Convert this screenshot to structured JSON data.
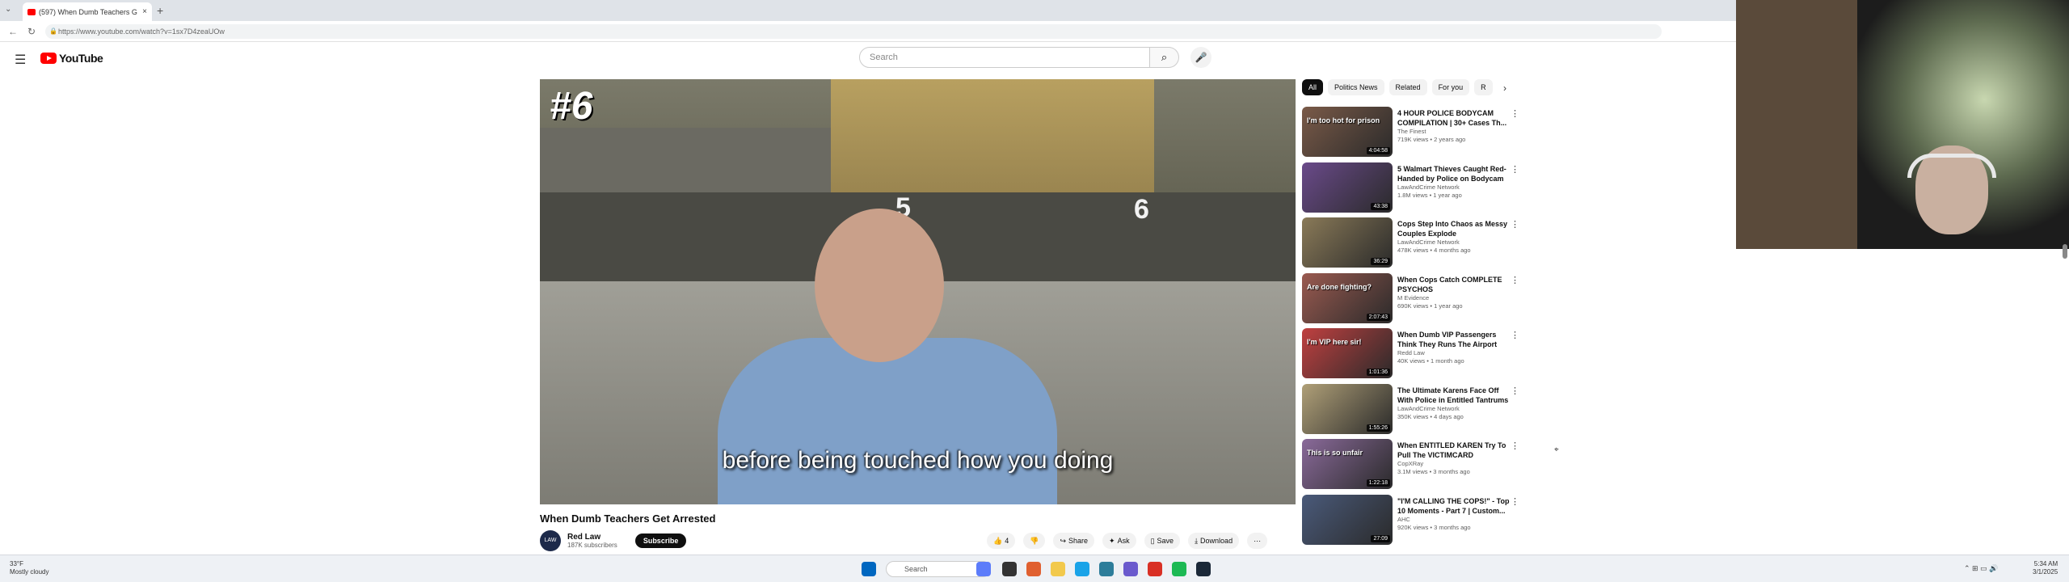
{
  "browser": {
    "tab_title": "(597) When Dumb Teachers G",
    "tab_close": "×",
    "new_tab": "+",
    "tab_menu": "⌄",
    "url": "https://www.youtube.com/watch?v=1sx7D4zeaUOw"
  },
  "youtube": {
    "logo_text": "YouTube",
    "search_placeholder": "Search"
  },
  "player": {
    "rank": "#6",
    "caption": "before being touched how you doing",
    "dock_numbers": [
      "5",
      "6"
    ]
  },
  "video": {
    "title": "When Dumb Teachers Get Arrested",
    "channel_name": "Red Law",
    "channel_avatar": "LAW",
    "subscribers": "187K subscribers",
    "subscribe_label": "Subscribe",
    "like_count": "4",
    "share_label": "Share",
    "ask_label": "Ask",
    "save_label": "Save",
    "download_label": "Download"
  },
  "chips": [
    "All",
    "Politics News",
    "Related",
    "For you",
    "R"
  ],
  "recommendations": [
    {
      "title": "4 HOUR POLICE BODYCAM COMPILATION | 30+ Cases Th...",
      "channel": "The Finest",
      "meta": "719K views • 2 years ago",
      "duration": "4:04:58",
      "thumb_text": "I'm too hot for prison",
      "color": "#7a5a48"
    },
    {
      "title": "5 Walmart Thieves Caught Red-Handed by Police on Bodycam",
      "channel": "LawAndCrime Network",
      "meta": "1.8M views • 1 year ago",
      "duration": "43:38",
      "thumb_text": "",
      "color": "#6a4a8a"
    },
    {
      "title": "Cops Step Into Chaos as Messy Couples Explode",
      "channel": "LawAndCrime Network",
      "meta": "478K views • 4 months ago",
      "duration": "36:29",
      "thumb_text": "",
      "color": "#8a7a58"
    },
    {
      "title": "When Cops Catch COMPLETE PSYCHOS",
      "channel": "M Evidence",
      "meta": "690K views • 1 year ago",
      "duration": "2:07:43",
      "thumb_text": "Are done fighting?",
      "color": "#9a5a50"
    },
    {
      "title": "When Dumb VIP Passengers Think They Runs The Airport",
      "channel": "Redd Law",
      "meta": "40K views • 1 month ago",
      "duration": "1:01:36",
      "thumb_text": "I'm VIP here sir!",
      "color": "#c04040"
    },
    {
      "title": "The Ultimate Karens Face Off With Police in Entitled Tantrums",
      "channel": "LawAndCrime Network",
      "meta": "350K views • 4 days ago",
      "duration": "1:55:26",
      "thumb_text": "",
      "color": "#b0a078"
    },
    {
      "title": "When ENTITLED KAREN Try To Pull The VICTIMCARD",
      "channel": "CopXRay",
      "meta": "3.1M views • 3 months ago",
      "duration": "1:22:18",
      "thumb_text": "This is so unfair",
      "color": "#8a6a9a"
    },
    {
      "title": "\"I'M CALLING THE COPS!\" - Top 10 Moments - Part 7 | Custom...",
      "channel": "AHC",
      "meta": "920K views • 3 months ago",
      "duration": "27:09",
      "thumb_text": "",
      "color": "#4a5a7a"
    }
  ],
  "taskbar": {
    "weather_temp": "33°F",
    "weather_desc": "Mostly cloudy",
    "search_label": "Search",
    "time": "5:34 AM",
    "date": "3/1/2025"
  }
}
